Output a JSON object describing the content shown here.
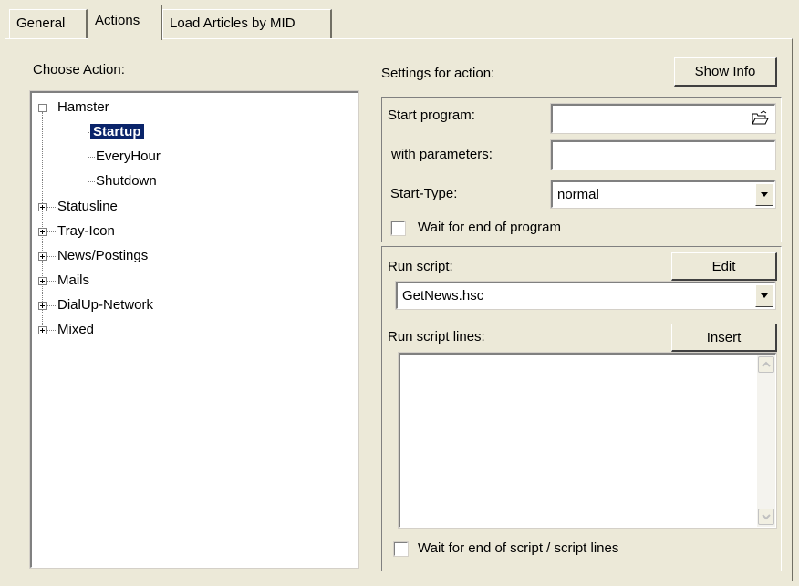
{
  "tabs": [
    "General",
    "Actions",
    "Load Articles by MID"
  ],
  "choose_action_label": "Choose Action:",
  "tree": {
    "root": "Hamster",
    "children": [
      "Startup",
      "EveryHour",
      "Shutdown"
    ],
    "siblings": [
      "Statusline",
      "Tray-Icon",
      "News/Postings",
      "Mails",
      "DialUp-Network",
      "Mixed"
    ]
  },
  "settings_label": "Settings for action:",
  "show_info_button": "Show Info",
  "program": {
    "start_program_label": "Start program:",
    "start_program_value": "",
    "with_parameters_label": "with parameters:",
    "with_parameters_value": "",
    "start_type_label": "Start-Type:",
    "start_type_value": "normal",
    "wait_program_label": "Wait for end of program"
  },
  "script": {
    "run_script_label": "Run script:",
    "edit_button": "Edit",
    "script_value": "GetNews.hsc",
    "run_script_lines_label": "Run script lines:",
    "insert_button": "Insert",
    "script_lines": "",
    "wait_script_label": "Wait for end of script / script lines"
  },
  "icons": {
    "open_file": "folder-open-icon",
    "dropdown": "chevron-down-icon",
    "scroll_up": "arrow-up-icon",
    "scroll_down": "arrow-down-icon"
  }
}
